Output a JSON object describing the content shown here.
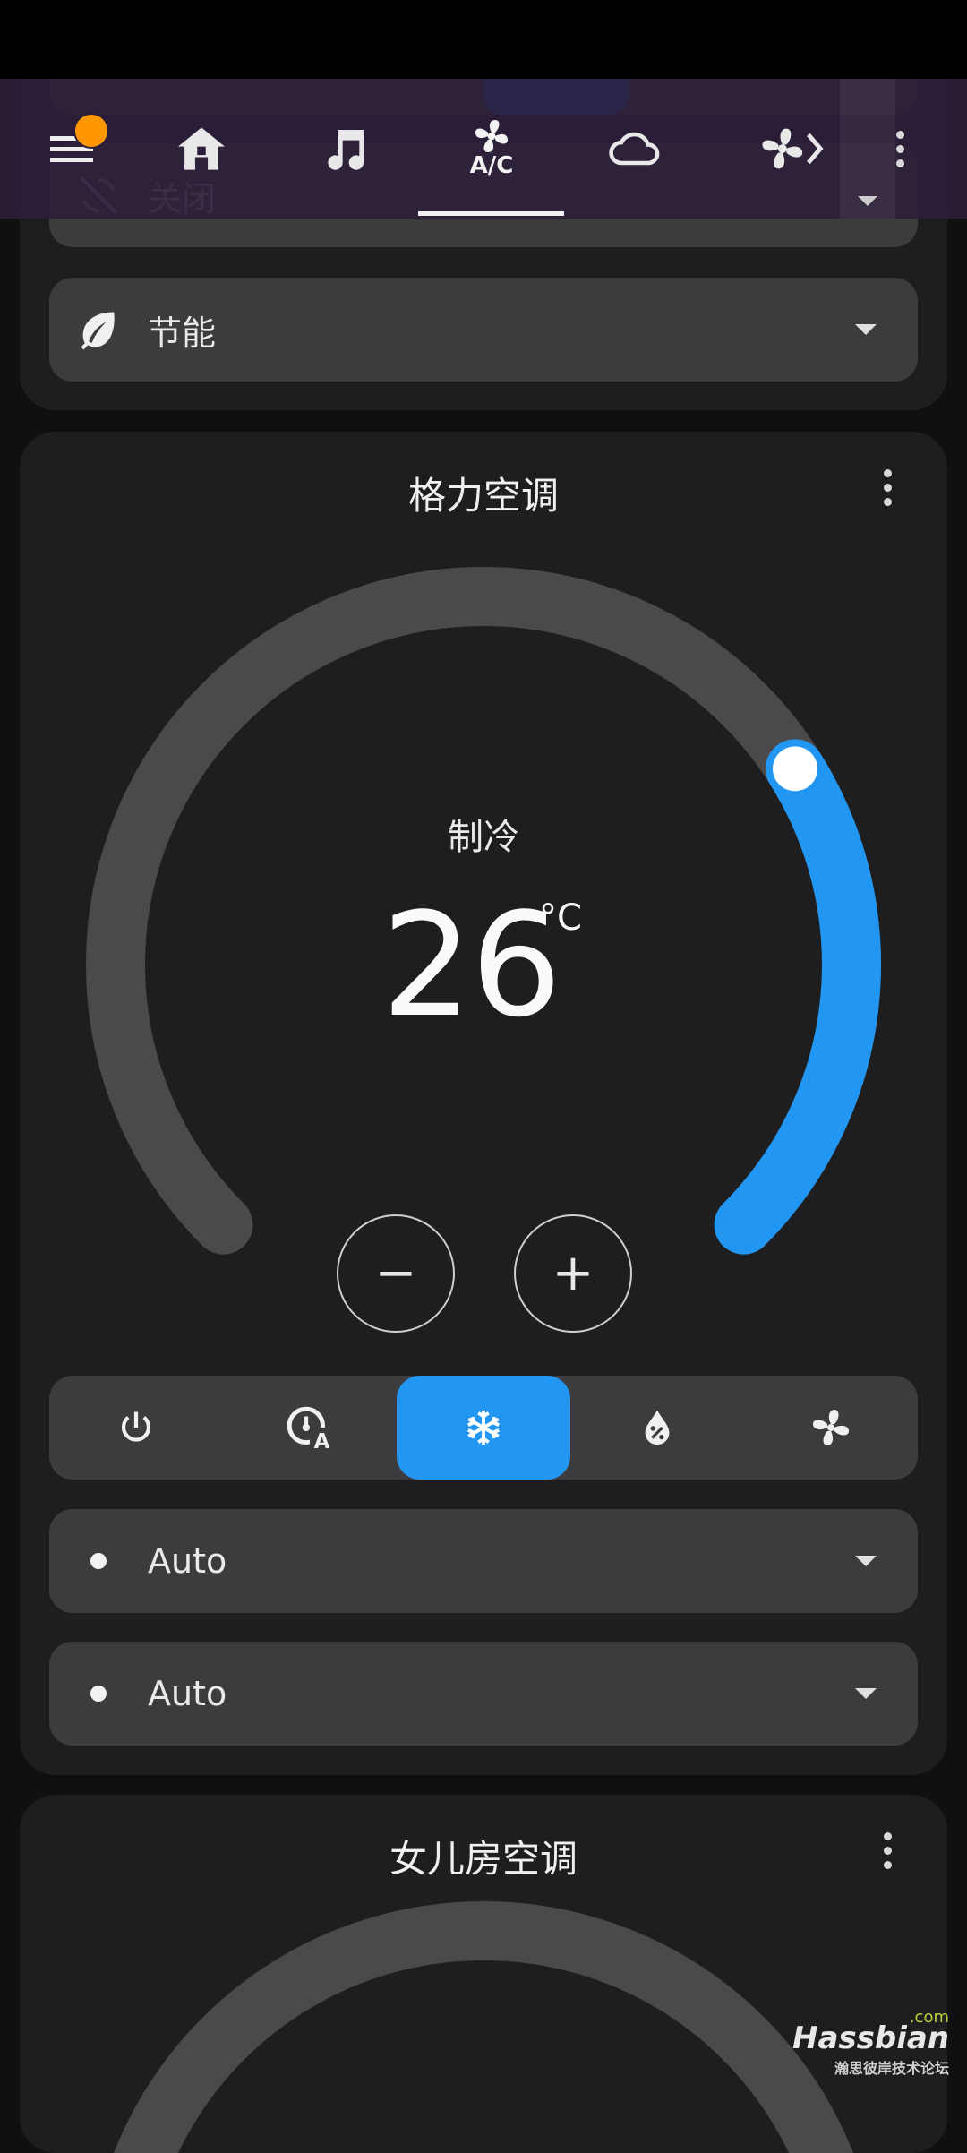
{
  "top_section": {
    "partial_select_value": "关闭",
    "preset_select_value": "节能"
  },
  "navbar": {
    "tabs": [
      {
        "name": "home"
      },
      {
        "name": "music"
      },
      {
        "name": "ac",
        "label": "A/C",
        "active": true
      },
      {
        "name": "weather"
      },
      {
        "name": "fan"
      }
    ],
    "badge_color": "#ff9800"
  },
  "ac_card": {
    "title": "格力空调",
    "mode_label": "制冷",
    "target_temperature": "26",
    "unit": "°C",
    "temperature_value": 26,
    "minus_label": "−",
    "plus_label": "+",
    "hvac_modes": [
      {
        "name": "off",
        "icon": "power-icon"
      },
      {
        "name": "auto",
        "icon": "thermostat-auto-icon"
      },
      {
        "name": "cool",
        "icon": "snowflake-icon",
        "active": true
      },
      {
        "name": "dry",
        "icon": "water-percent-icon"
      },
      {
        "name": "fan_only",
        "icon": "fan-icon"
      }
    ],
    "fan_mode": "Auto",
    "swing_mode": "Auto",
    "accent": "#2196f3"
  },
  "second_card": {
    "title": "女儿房空调"
  },
  "watermark": {
    "brand": "Hassbian",
    "com": ".com",
    "sub": "瀚思彼岸技术论坛"
  }
}
